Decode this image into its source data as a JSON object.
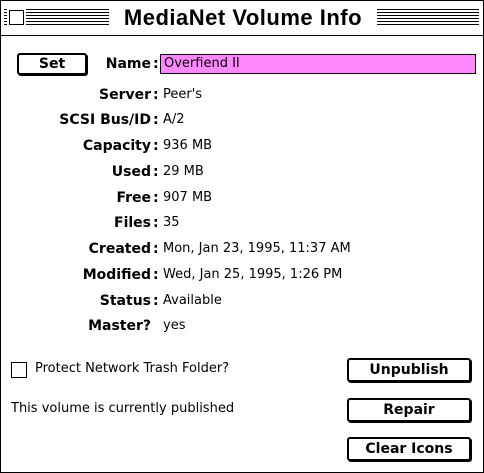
{
  "window": {
    "title": "MediaNet Volume Info"
  },
  "set_button": "Set",
  "name": {
    "label": "Name",
    "value": "Overfiend II"
  },
  "fields": [
    {
      "label": "Server",
      "value": "Peer's"
    },
    {
      "label": "SCSI Bus/ID",
      "value": "A/2"
    },
    {
      "label": "Capacity",
      "value": "936 MB"
    },
    {
      "label": "Used",
      "value": "29 MB"
    },
    {
      "label": "Free",
      "value": "907 MB"
    },
    {
      "label": "Files",
      "value": "35"
    },
    {
      "label": "Created",
      "value": "Mon, Jan 23, 1995, 11:37 AM"
    },
    {
      "label": "Modified",
      "value": "Wed, Jan 25, 1995, 1:26 PM"
    },
    {
      "label": "Status",
      "value": "Available"
    },
    {
      "label": "Master?",
      "value": "yes"
    }
  ],
  "colon": ":",
  "protect_checkbox": {
    "label": "Protect Network Trash Folder?",
    "checked": false
  },
  "status_message": "This volume is currently published",
  "buttons": {
    "unpublish": "Unpublish",
    "repair": "Repair",
    "clear_icons": "Clear Icons"
  },
  "colors": {
    "name_field_bg": "#ff88ff"
  }
}
